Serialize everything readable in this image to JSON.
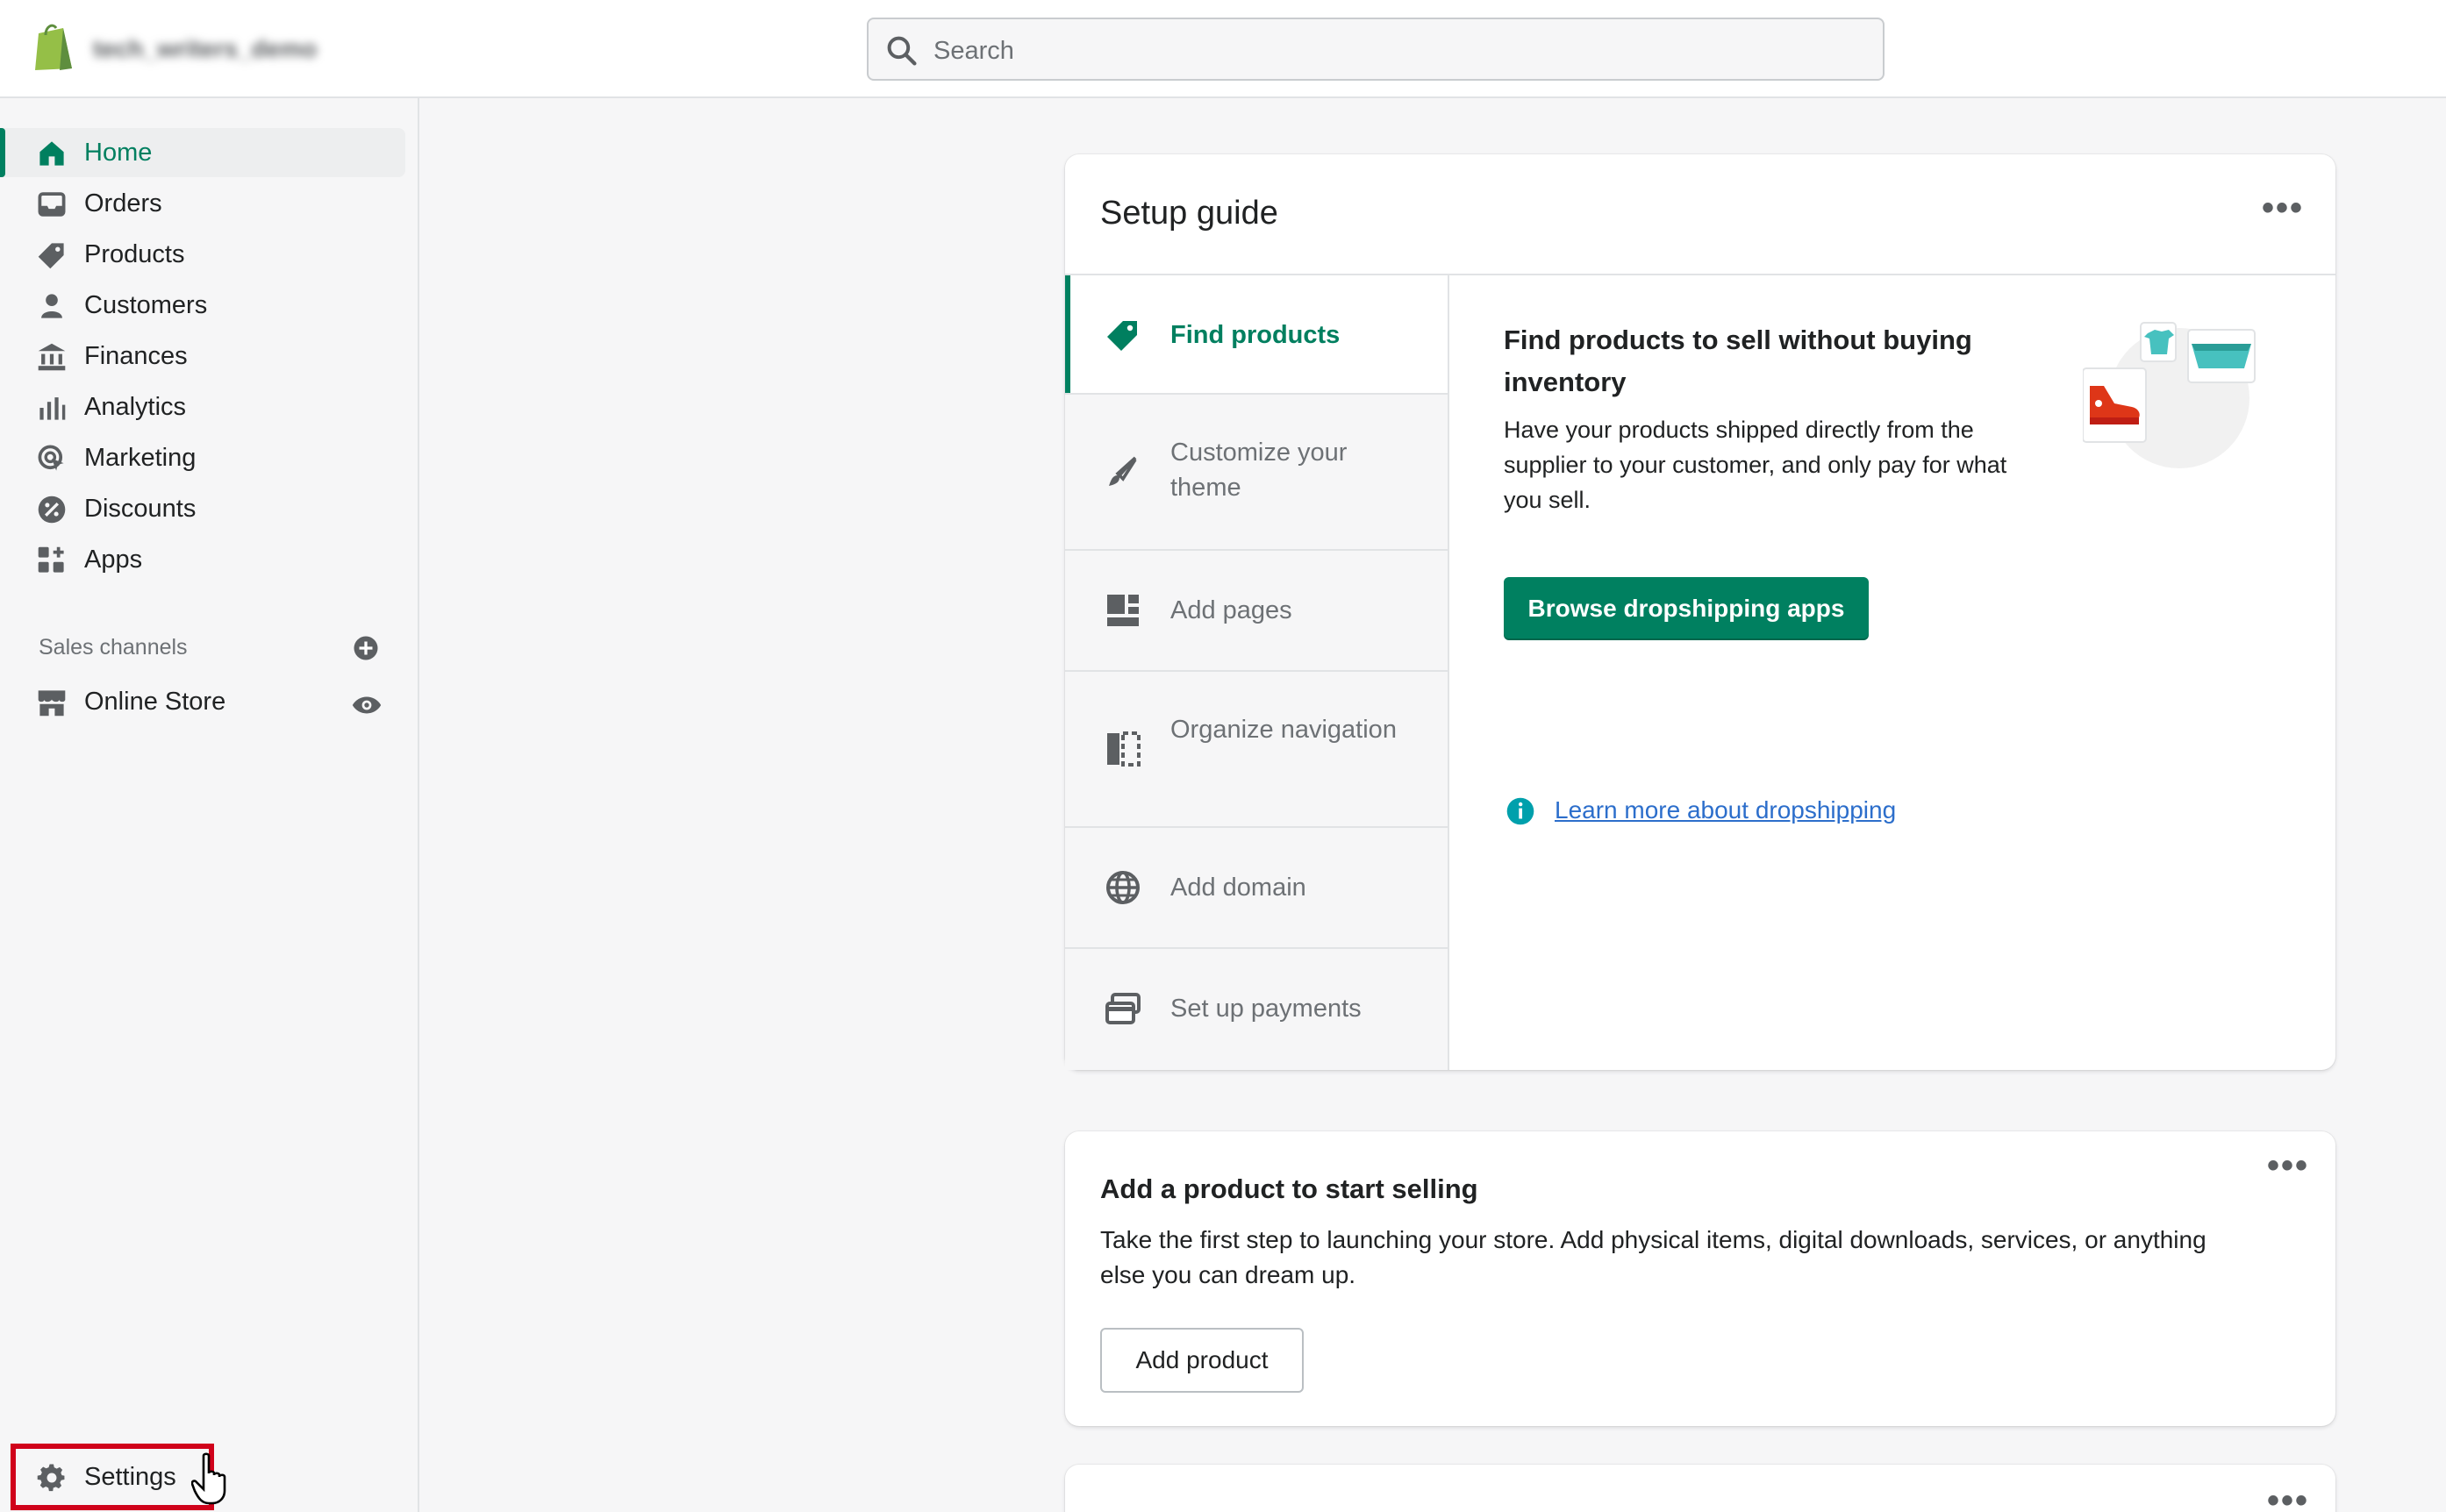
{
  "topbar": {
    "store_name": "tech_writers_demo",
    "search_placeholder": "Search"
  },
  "sidebar": {
    "items": [
      {
        "label": "Home",
        "icon": "home-icon",
        "active": true
      },
      {
        "label": "Orders",
        "icon": "inbox-icon"
      },
      {
        "label": "Products",
        "icon": "tag-icon"
      },
      {
        "label": "Customers",
        "icon": "person-icon"
      },
      {
        "label": "Finances",
        "icon": "bank-icon"
      },
      {
        "label": "Analytics",
        "icon": "bar-chart-icon"
      },
      {
        "label": "Marketing",
        "icon": "target-icon"
      },
      {
        "label": "Discounts",
        "icon": "discount-icon"
      },
      {
        "label": "Apps",
        "icon": "apps-icon"
      }
    ],
    "sales_channels_title": "Sales channels",
    "online_store_label": "Online Store",
    "settings_label": "Settings"
  },
  "setup_guide": {
    "title": "Setup guide",
    "steps": [
      {
        "label": "Find products",
        "icon": "tag-icon",
        "active": true
      },
      {
        "label": "Customize your theme",
        "icon": "brush-icon"
      },
      {
        "label": "Add pages",
        "icon": "pages-icon"
      },
      {
        "label": "Organize navigation",
        "icon": "navigation-icon"
      },
      {
        "label": "Add domain",
        "icon": "globe-icon"
      },
      {
        "label": "Set up payments",
        "icon": "payment-icon"
      }
    ],
    "detail_title": "Find products to sell without buying inventory",
    "detail_text": "Have your products shipped directly from the supplier to your customer, and only pay for what you sell.",
    "primary_button": "Browse dropshipping apps",
    "learn_more": "Learn more about dropshipping"
  },
  "add_product_card": {
    "title": "Add a product to start selling",
    "text": "Take the first step to launching your store. Add physical items, digital downloads, services, or anything else you can dream up.",
    "button": "Add product"
  },
  "colors": {
    "accent": "#008060",
    "highlight_box": "#d0021b",
    "link": "#2c6ecb"
  }
}
